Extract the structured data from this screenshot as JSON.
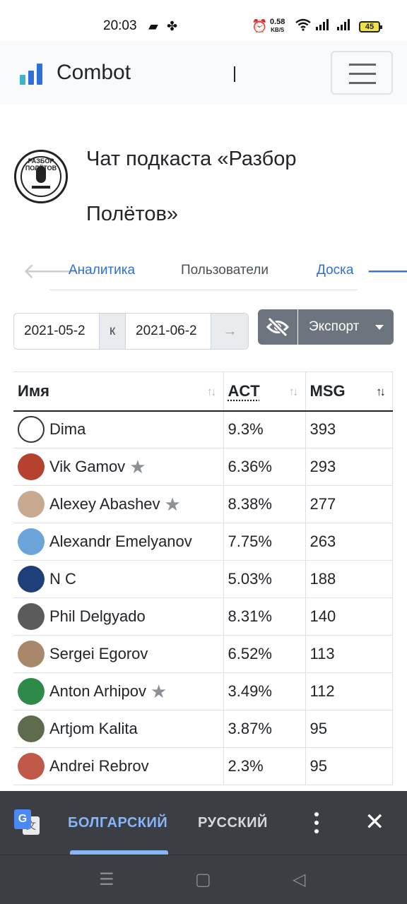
{
  "status_bar": {
    "time": "20:03",
    "speed_value": "0.58",
    "speed_unit": "KB/S",
    "battery": "45"
  },
  "navbar": {
    "brand": "Combot",
    "logo_colors": [
      "#3bb6c7",
      "#2f6fd8",
      "#2f6fd8"
    ]
  },
  "header": {
    "title": "Чат подкаста «Разбор Полётов»",
    "logo_text": "РАЗБОР ПОЛЁТОВ"
  },
  "tabs": {
    "items": [
      {
        "label": "Аналитика",
        "color": "#2f6fd8"
      },
      {
        "label": "Пользователи",
        "color": "#495057"
      },
      {
        "label": "Доска",
        "color": "#2f6fd8"
      }
    ]
  },
  "filters": {
    "date_from": "2021-05-2",
    "date_sep": "к",
    "date_to": "2021-06-2",
    "go_label": "→",
    "export_label": "Экспорт"
  },
  "table": {
    "headers": {
      "name": "Имя",
      "act": "ACT",
      "msg": "MSG"
    },
    "rows": [
      {
        "name": "Dima",
        "act": "9.3%",
        "msg": "393",
        "star": false,
        "avatar": "#ffffff"
      },
      {
        "name": "Vik Gamov",
        "act": "6.36%",
        "msg": "293",
        "star": true,
        "avatar": "#b5412f"
      },
      {
        "name": "Alexey Abashev",
        "act": "8.38%",
        "msg": "277",
        "star": true,
        "avatar": "#c9a890"
      },
      {
        "name": "Alexandr Emelyanov",
        "act": "7.75%",
        "msg": "263",
        "star": false,
        "avatar": "#6aa4d8"
      },
      {
        "name": "N C",
        "act": "5.03%",
        "msg": "188",
        "star": false,
        "avatar": "#1e3f7a"
      },
      {
        "name": "Phil Delgyado",
        "act": "8.31%",
        "msg": "140",
        "star": false,
        "avatar": "#5a5a5a"
      },
      {
        "name": "Sergei Egorov",
        "act": "6.52%",
        "msg": "113",
        "star": false,
        "avatar": "#a8876a"
      },
      {
        "name": "Anton Arhipov",
        "act": "3.49%",
        "msg": "112",
        "star": true,
        "avatar": "#2e8a4a"
      },
      {
        "name": "Artjom Kalita",
        "act": "3.87%",
        "msg": "95",
        "star": false,
        "avatar": "#5d6a4c"
      },
      {
        "name": "Andrei Rebrov",
        "act": "2.3%",
        "msg": "95",
        "star": false,
        "avatar": "#c05a48"
      }
    ]
  },
  "translate_bar": {
    "lang_source": "БОЛГАРСКИЙ",
    "lang_target": "РУССКИЙ",
    "active_color": "#8ab4f8"
  }
}
